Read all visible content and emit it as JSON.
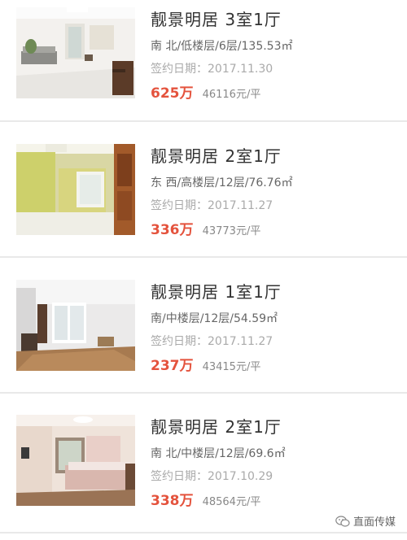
{
  "listings": [
    {
      "title": "靓景明居 3室1厅",
      "specs": "南 北/低楼层/6层/135.53㎡",
      "date_label": "签约日期：",
      "date": "2017.11.30",
      "price": "625万",
      "unit_price": "46116元/平"
    },
    {
      "title": "靓景明居 2室1厅",
      "specs": "东 西/高楼层/12层/76.76㎡",
      "date_label": "签约日期：",
      "date": "2017.11.27",
      "price": "336万",
      "unit_price": "43773元/平"
    },
    {
      "title": "靓景明居 1室1厅",
      "specs": "南/中楼层/12层/54.59㎡",
      "date_label": "签约日期：",
      "date": "2017.11.27",
      "price": "237万",
      "unit_price": "43415元/平"
    },
    {
      "title": "靓景明居 2室1厅",
      "specs": "南 北/中楼层/12层/69.6㎡",
      "date_label": "签约日期：",
      "date": "2017.10.29",
      "price": "338万",
      "unit_price": "48564元/平"
    }
  ],
  "watermark": {
    "text": "直面传媒",
    "icon": "wechat-icon"
  },
  "colors": {
    "price": "#e4533d",
    "separator": "#e9e9e9",
    "muted": "#aaaaaa"
  }
}
